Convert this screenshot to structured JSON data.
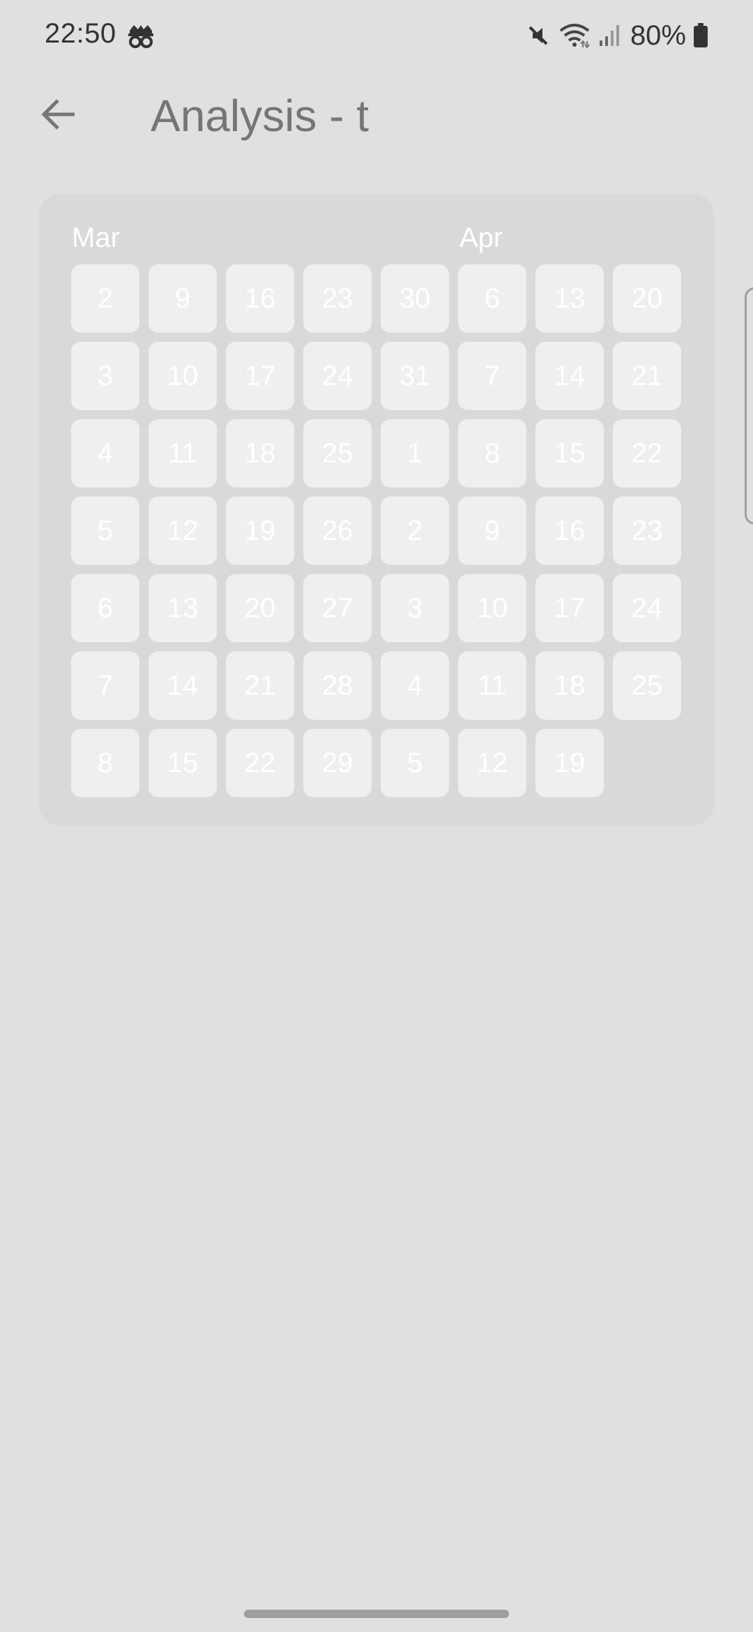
{
  "status_bar": {
    "time": "22:50",
    "app_icon": "incognito-icon",
    "icons": [
      "mute-icon",
      "wifi-icon",
      "signal-icon",
      "battery-icon"
    ],
    "battery_percent": "80%"
  },
  "app_bar": {
    "back_icon": "arrow-back-icon",
    "title": "Analysis - t"
  },
  "calendar": {
    "months": [
      "Mar",
      "Apr"
    ],
    "weeks": [
      [
        "2",
        "3",
        "4",
        "5",
        "6",
        "7",
        "8"
      ],
      [
        "9",
        "10",
        "11",
        "12",
        "13",
        "14",
        "15"
      ],
      [
        "16",
        "17",
        "18",
        "19",
        "20",
        "21",
        "22"
      ],
      [
        "23",
        "24",
        "25",
        "26",
        "27",
        "28",
        "29"
      ],
      [
        "30",
        "31",
        "1",
        "2",
        "3",
        "4",
        "5"
      ],
      [
        "6",
        "7",
        "8",
        "9",
        "10",
        "11",
        "12"
      ],
      [
        "13",
        "14",
        "15",
        "16",
        "17",
        "18",
        "19"
      ],
      [
        "20",
        "21",
        "22",
        "23",
        "24",
        "25"
      ]
    ]
  },
  "colors": {
    "background": "#e0e0e0",
    "card": "#d9d9d9",
    "cell": "#efefef",
    "title": "#757575",
    "status_text": "#333333"
  }
}
